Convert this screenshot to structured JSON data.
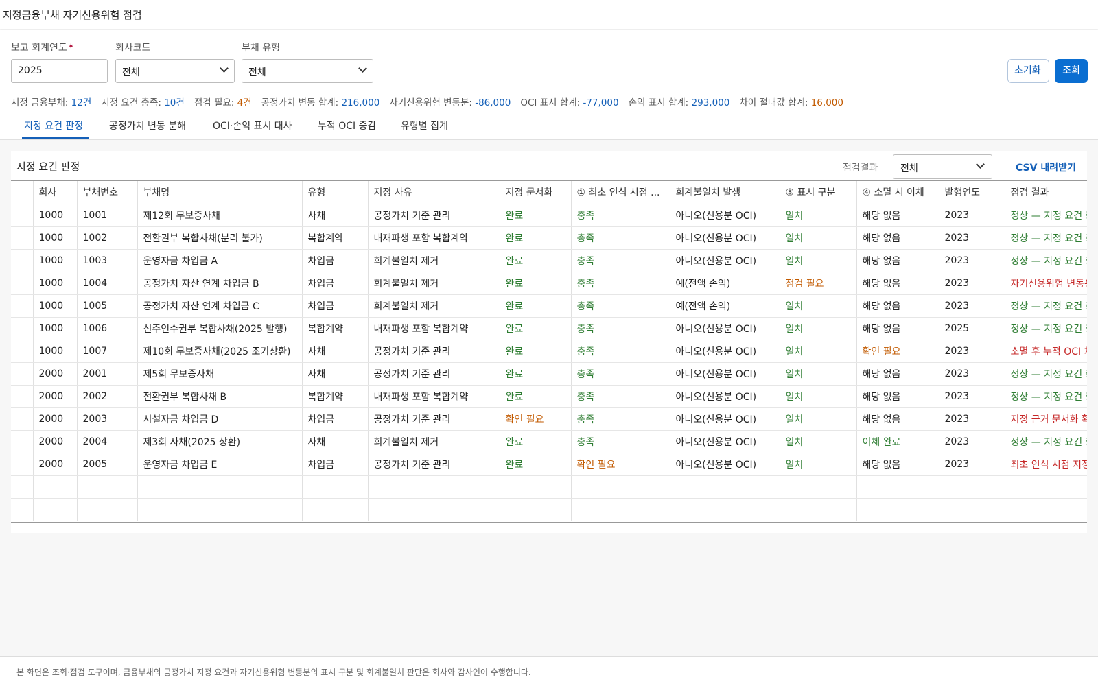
{
  "header": {
    "title": "지정금융부채 자기신용위험 점검"
  },
  "filters": {
    "year_label": "보고 회계연도",
    "year_required_mark": "*",
    "year_value": "2025",
    "company_label": "회사코드",
    "company_value": "전체",
    "debt_type_label": "부채 유형",
    "debt_type_value": "전체",
    "reset_label": "초기화",
    "search_label": "조회"
  },
  "summary": [
    {
      "label": "지정 금융부채: ",
      "value": "12건",
      "tone": "blue"
    },
    {
      "label": "지정 요건 충족: ",
      "value": "10건",
      "tone": "blue"
    },
    {
      "label": "점검 필요: ",
      "value": "4건",
      "tone": "orange"
    },
    {
      "label": "공정가치 변동 합계: ",
      "value": "216,000",
      "tone": "blue"
    },
    {
      "label": "자기신용위험 변동분: ",
      "value": "-86,000",
      "tone": "blue"
    },
    {
      "label": "OCI 표시 합계: ",
      "value": "-77,000",
      "tone": "blue"
    },
    {
      "label": "손익 표시 합계: ",
      "value": "293,000",
      "tone": "blue"
    },
    {
      "label": "차이 절대값 합계: ",
      "value": "16,000",
      "tone": "orange"
    }
  ],
  "tabs": [
    {
      "label": "지정 요건 판정",
      "active": true
    },
    {
      "label": "공정가치 변동 분해",
      "active": false
    },
    {
      "label": "OCI·손익 표시 대사",
      "active": false
    },
    {
      "label": "누적 OCI 증감",
      "active": false
    },
    {
      "label": "유형별 집계",
      "active": false
    }
  ],
  "panel": {
    "title": "지정 요건 판정",
    "result_filter_label": "점검결과",
    "result_filter_value": "전체",
    "csv_label": "CSV 내려받기"
  },
  "table": {
    "columns": [
      "",
      "회사",
      "부채번호",
      "부채명",
      "유형",
      "지정 사유",
      "지정 문서화",
      "① 최초 인식 시점 ...",
      "회계불일치 발생",
      "③ 표시 구분",
      "④ 소멸 시 이체",
      "발행연도",
      "점검 결과"
    ],
    "rows": [
      [
        "",
        "1000",
        "1001",
        "제12회 무보증사채",
        "사채",
        "공정가치 기준 관리",
        "완료",
        "충족",
        "아니오(신용분 OCI)",
        "일치",
        "해당 없음",
        "2023",
        "정상 — 지정 요건 충족"
      ],
      [
        "",
        "1000",
        "1002",
        "전환권부 복합사채(분리 불가)",
        "복합계약",
        "내재파생 포함 복합계약",
        "완료",
        "충족",
        "아니오(신용분 OCI)",
        "일치",
        "해당 없음",
        "2023",
        "정상 — 지정 요건 충족"
      ],
      [
        "",
        "1000",
        "1003",
        "운영자금 차입금 A",
        "차입금",
        "회계불일치 제거",
        "완료",
        "충족",
        "아니오(신용분 OCI)",
        "일치",
        "해당 없음",
        "2023",
        "정상 — 지정 요건 충족"
      ],
      [
        "",
        "1000",
        "1004",
        "공정가치 자산 연계 차입금 B",
        "차입금",
        "회계불일치 제거",
        "완료",
        "충족",
        "예(전액 손익)",
        "점검 필요",
        "해당 없음",
        "2023",
        "자기신용위험 변동분 표시 점검"
      ],
      [
        "",
        "1000",
        "1005",
        "공정가치 자산 연계 차입금 C",
        "차입금",
        "회계불일치 제거",
        "완료",
        "충족",
        "예(전액 손익)",
        "일치",
        "해당 없음",
        "2023",
        "정상 — 지정 요건 충족"
      ],
      [
        "",
        "1000",
        "1006",
        "신주인수권부 복합사채(2025 발행)",
        "복합계약",
        "내재파생 포함 복합계약",
        "완료",
        "충족",
        "아니오(신용분 OCI)",
        "일치",
        "해당 없음",
        "2025",
        "정상 — 지정 요건 충족"
      ],
      [
        "",
        "1000",
        "1007",
        "제10회 무보증사채(2025 조기상환)",
        "사채",
        "공정가치 기준 관리",
        "완료",
        "충족",
        "아니오(신용분 OCI)",
        "일치",
        "확인 필요",
        "2023",
        "소멸 후 누적 OCI 처리 확인"
      ],
      [
        "",
        "2000",
        "2001",
        "제5회 무보증사채",
        "사채",
        "공정가치 기준 관리",
        "완료",
        "충족",
        "아니오(신용분 OCI)",
        "일치",
        "해당 없음",
        "2023",
        "정상 — 지정 요건 충족"
      ],
      [
        "",
        "2000",
        "2002",
        "전환권부 복합사채 B",
        "복합계약",
        "내재파생 포함 복합계약",
        "완료",
        "충족",
        "아니오(신용분 OCI)",
        "일치",
        "해당 없음",
        "2023",
        "정상 — 지정 요건 충족"
      ],
      [
        "",
        "2000",
        "2003",
        "시설자금 차입금 D",
        "차입금",
        "공정가치 기준 관리",
        "확인 필요",
        "충족",
        "아니오(신용분 OCI)",
        "일치",
        "해당 없음",
        "2023",
        "지정 근거 문서화 확인"
      ],
      [
        "",
        "2000",
        "2004",
        "제3회 사채(2025 상환)",
        "사채",
        "회계불일치 제거",
        "완료",
        "충족",
        "아니오(신용분 OCI)",
        "일치",
        "이체 완료",
        "2023",
        "정상 — 지정 요건 충족"
      ],
      [
        "",
        "2000",
        "2005",
        "운영자금 차입금 E",
        "차입금",
        "공정가치 기준 관리",
        "완료",
        "확인 필요",
        "아니오(신용분 OCI)",
        "일치",
        "해당 없음",
        "2023",
        "최초 인식 시점 지정 확인"
      ]
    ],
    "tones": [
      [
        "",
        "",
        "",
        "",
        "",
        "",
        "ok",
        "ok",
        "",
        "ok",
        "",
        "",
        "ok"
      ],
      [
        "",
        "",
        "",
        "",
        "",
        "",
        "ok",
        "ok",
        "",
        "ok",
        "",
        "",
        "ok"
      ],
      [
        "",
        "",
        "",
        "",
        "",
        "",
        "ok",
        "ok",
        "",
        "ok",
        "",
        "",
        "ok"
      ],
      [
        "",
        "",
        "",
        "",
        "",
        "",
        "ok",
        "ok",
        "",
        "warn",
        "",
        "",
        "bad"
      ],
      [
        "",
        "",
        "",
        "",
        "",
        "",
        "ok",
        "ok",
        "",
        "ok",
        "",
        "",
        "ok"
      ],
      [
        "",
        "",
        "",
        "",
        "",
        "",
        "ok",
        "ok",
        "",
        "ok",
        "",
        "",
        "ok"
      ],
      [
        "",
        "",
        "",
        "",
        "",
        "",
        "ok",
        "ok",
        "",
        "ok",
        "warn",
        "",
        "bad"
      ],
      [
        "",
        "",
        "",
        "",
        "",
        "",
        "ok",
        "ok",
        "",
        "ok",
        "",
        "",
        "ok"
      ],
      [
        "",
        "",
        "",
        "",
        "",
        "",
        "ok",
        "ok",
        "",
        "ok",
        "",
        "",
        "ok"
      ],
      [
        "",
        "",
        "",
        "",
        "",
        "",
        "warn",
        "ok",
        "",
        "ok",
        "",
        "",
        "bad"
      ],
      [
        "",
        "",
        "",
        "",
        "",
        "",
        "ok",
        "ok",
        "",
        "ok",
        "ok",
        "",
        "ok"
      ],
      [
        "",
        "",
        "",
        "",
        "",
        "",
        "ok",
        "warn",
        "",
        "ok",
        "",
        "",
        "bad"
      ]
    ],
    "empty_rows": 2
  },
  "footer": {
    "note": "본 화면은 조회·점검 도구이며, 금융부채의 공정가치 지정 요건과 자기신용위험 변동분의 표시 구분 및 회계불일치 판단은 회사와 감사인이 수행합니다."
  },
  "colors": {
    "accent": "#0a6ed1",
    "ok": "#2e7d32",
    "warn": "#c25a00",
    "bad": "#c62828"
  }
}
